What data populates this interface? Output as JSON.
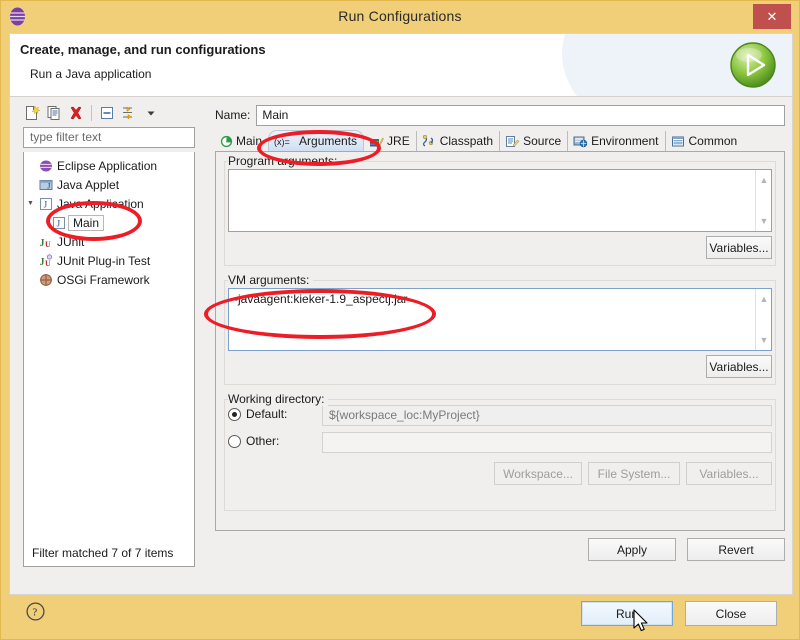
{
  "window": {
    "title": "Run Configurations",
    "close_label": "✕",
    "app_icon": "eclipse-icon"
  },
  "header": {
    "title": "Create, manage, and run configurations",
    "subtitle": "Run a Java application",
    "run_icon": "run-green-play-icon"
  },
  "toolbar": {
    "buttons": [
      {
        "name": "new-launch-configuration-icon",
        "title": "New launch configuration"
      },
      {
        "name": "duplicate-icon",
        "title": "Duplicate"
      },
      {
        "name": "delete-icon",
        "title": "Delete"
      },
      {
        "name": "collapse-all-icon",
        "title": "Collapse All"
      },
      {
        "name": "filter-icon",
        "title": "Filter launch configurations"
      },
      {
        "name": "chevron-down-icon",
        "title": "View Menu"
      }
    ]
  },
  "filter": {
    "placeholder": "type filter text",
    "value": "",
    "status": "Filter matched 7 of 7 items"
  },
  "tree": {
    "items": [
      {
        "label": "Eclipse Application",
        "icon": "eclipse-purple-icon",
        "indent": 0,
        "expander": "",
        "selected": false
      },
      {
        "label": "Java Applet",
        "icon": "java-applet-icon",
        "indent": 0,
        "expander": "",
        "selected": false
      },
      {
        "label": "Java Application",
        "icon": "java-application-icon",
        "indent": 0,
        "expander": "▾",
        "selected": false
      },
      {
        "label": "Main",
        "icon": "java-application-icon",
        "indent": 1,
        "expander": "",
        "selected": true
      },
      {
        "label": "JUnit",
        "icon": "junit-icon",
        "indent": 0,
        "expander": "",
        "selected": false
      },
      {
        "label": "JUnit Plug-in Test",
        "icon": "junit-plugin-icon",
        "indent": 0,
        "expander": "",
        "selected": false
      },
      {
        "label": "OSGi Framework",
        "icon": "osgi-icon",
        "indent": 0,
        "expander": "",
        "selected": false
      }
    ]
  },
  "config": {
    "name_label": "Name:",
    "name_value": "Main"
  },
  "tabs": [
    {
      "label": "Main",
      "icon": "main-green-icon",
      "selected": false
    },
    {
      "label": "Arguments",
      "icon": "arguments-var-icon",
      "selected": true
    },
    {
      "label": "JRE",
      "icon": "jre-books-icon",
      "selected": false
    },
    {
      "label": "Classpath",
      "icon": "classpath-icon",
      "selected": false
    },
    {
      "label": "Source",
      "icon": "source-icon",
      "selected": false
    },
    {
      "label": "Environment",
      "icon": "environment-icon",
      "selected": false
    },
    {
      "label": "Common",
      "icon": "common-icon",
      "selected": false
    }
  ],
  "arguments_tab": {
    "program_arguments": {
      "label": "Program arguments:",
      "value": "",
      "variables_button": "Variables..."
    },
    "vm_arguments": {
      "label": "VM arguments:",
      "value": "-javaagent:kieker-1.9_aspectj.jar",
      "variables_button": "Variables..."
    },
    "working_directory": {
      "label": "Working directory:",
      "default_label": "Default:",
      "default_selected": true,
      "default_value": "${workspace_loc:MyProject}",
      "other_label": "Other:",
      "other_selected": false,
      "other_value": "",
      "workspace_button": "Workspace...",
      "file_system_button": "File System...",
      "variables_button": "Variables..."
    }
  },
  "buttons": {
    "apply": "Apply",
    "revert": "Revert",
    "run": "Run",
    "close": "Close",
    "help_icon": "help-question-icon"
  },
  "colors": {
    "title_bar": "#f0cf78",
    "close_button": "#c0504d",
    "annotation": "#ee1c25",
    "accent_tab": "#cfe0f2",
    "run_icon_green": "#7ac143"
  },
  "annotations": [
    {
      "name": "annotation-arguments-tab",
      "target": "Arguments tab"
    },
    {
      "name": "annotation-main-tree-item",
      "target": "Main tree item"
    },
    {
      "name": "annotation-vm-arguments",
      "target": "VM arguments field"
    }
  ]
}
